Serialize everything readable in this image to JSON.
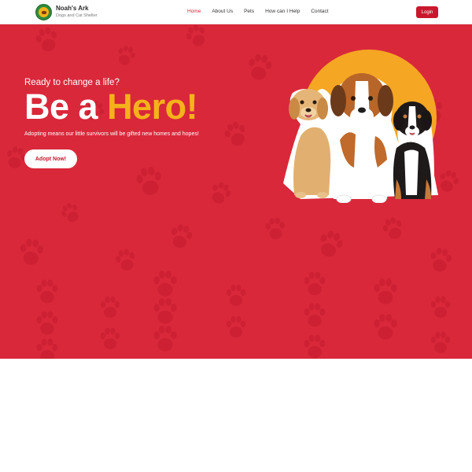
{
  "brand": {
    "name": "Noah's Ark",
    "tagline": "Dogs and Cat Shelter",
    "logo_icon": "shelter-logo-icon"
  },
  "nav": {
    "items": [
      {
        "label": "Home",
        "active": true
      },
      {
        "label": "About Us",
        "active": false
      },
      {
        "label": "Pets",
        "active": false
      },
      {
        "label": "How can I Help",
        "active": false
      },
      {
        "label": "Contact",
        "active": false
      }
    ],
    "login_label": "Login"
  },
  "hero": {
    "eyebrow": "Ready to change a life?",
    "headline_part1": "Be a ",
    "headline_part2": "Hero!",
    "subtext": "Adopting means our little survivors will be gifted new homes and hopes!",
    "cta_label": "Adopt Now!",
    "image": "three-puppies-illustration"
  },
  "colors": {
    "brand_red": "#d9283a",
    "accent_yellow": "#f5b31a",
    "button_red": "#c8192c",
    "paw_pattern": "#c91f32"
  }
}
